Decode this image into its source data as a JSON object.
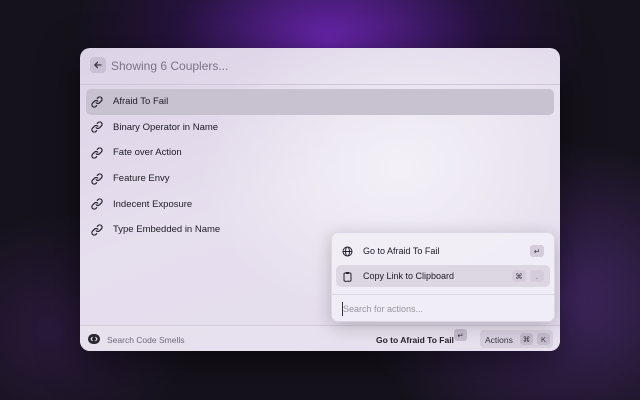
{
  "header": {
    "title": "Showing 6 Couplers..."
  },
  "list": {
    "items": [
      {
        "label": "Afraid To Fail",
        "selected": true
      },
      {
        "label": "Binary Operator in Name"
      },
      {
        "label": "Fate over Action"
      },
      {
        "label": "Feature Envy"
      },
      {
        "label": "Indecent Exposure"
      },
      {
        "label": "Type Embedded in Name"
      }
    ]
  },
  "footer": {
    "label": "Search Code Smells",
    "primary_action": "Go to Afraid To Fail",
    "enter_key": "↵",
    "actions_label": "Actions",
    "actions_keys": [
      "⌘",
      "K"
    ]
  },
  "menu": {
    "items": [
      {
        "label": "Go to Afraid To Fail",
        "icon": "globe-icon",
        "shortcut": [
          "↵"
        ]
      },
      {
        "label": "Copy Link to Clipboard",
        "icon": "clipboard-icon",
        "shortcut": [
          "⌘",
          "."
        ],
        "selected": true
      }
    ],
    "search_placeholder": "Search for actions..."
  },
  "colors": {
    "selected_row": "#c8c1d0",
    "text": "#1f1b26",
    "muted": "#7b7485"
  }
}
